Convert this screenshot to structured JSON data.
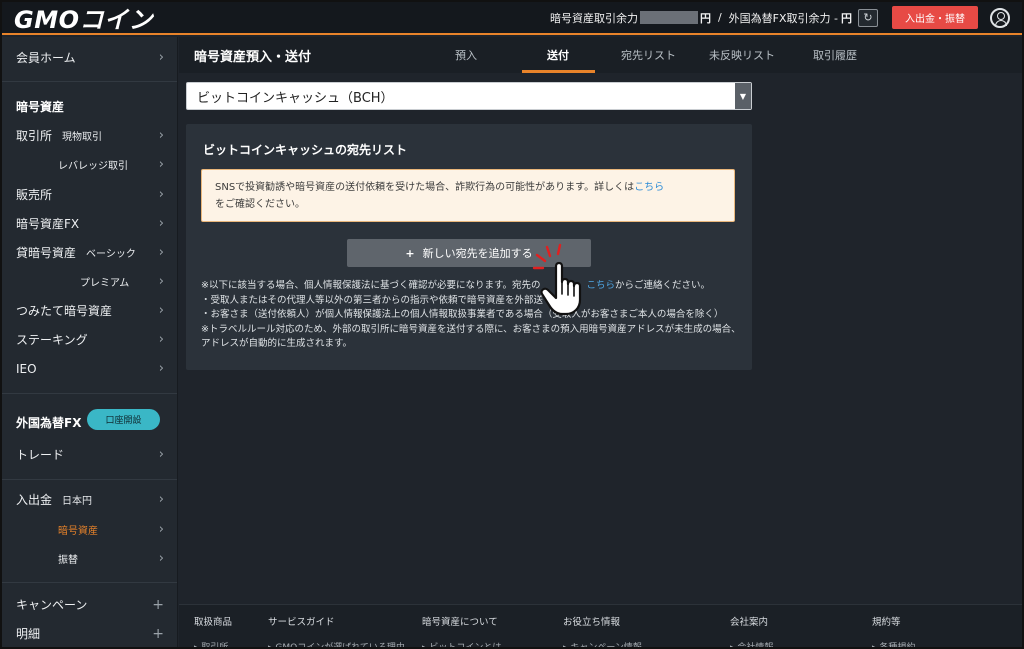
{
  "header": {
    "logo": "GMOコイン",
    "crypto_balance_label": "暗号資産取引余力",
    "crypto_balance_unit": "円",
    "separator": "/",
    "fx_balance_label": "外国為替FX取引余力 -",
    "fx_balance_unit": "円",
    "refresh_icon": "refresh-icon",
    "deposit_button": "入出金・振替"
  },
  "sidebar": {
    "member_home": "会員ホーム",
    "crypto_heading": "暗号資産",
    "exchange": "取引所",
    "exchange_spot": "現物取引",
    "exchange_leverage": "レバレッジ取引",
    "sales": "販売所",
    "crypto_fx": "暗号資産FX",
    "lending": "貸暗号資産",
    "lending_basic": "ベーシック",
    "lending_premium": "プレミアム",
    "tsumitate": "つみたて暗号資産",
    "staking": "ステーキング",
    "ieo": "IEO",
    "fx_heading": "外国為替FX",
    "fx_open_account": "口座開設",
    "trade": "トレード",
    "deposit": "入出金",
    "deposit_jpy": "日本円",
    "deposit_crypto": "暗号資産",
    "transfer": "振替",
    "campaign": "キャンペーン",
    "statement": "明細"
  },
  "main": {
    "page_title": "暗号資産預入・送付",
    "tabs": [
      {
        "label": "預入",
        "active": false
      },
      {
        "label": "送付",
        "active": true
      },
      {
        "label": "宛先リスト",
        "active": false
      },
      {
        "label": "未反映リスト",
        "active": false
      },
      {
        "label": "取引履歴",
        "active": false
      }
    ],
    "currency_select_value": "ビットコインキャッシュ（BCH）",
    "panel_title": "ビットコインキャッシュの宛先リスト",
    "warning_text": "SNSで投資勧誘や暗号資産の送付依頼を受けた場合、詐欺行為の可能性があります。詳しくは",
    "warning_link": "こちら",
    "warning_text_end": "をご確認ください。",
    "add_button": "新しい宛先を追加する",
    "notes": {
      "line1_start": "※以下に該当する場合、個人情報保護法に基づく確認が必要になります。宛先の",
      "line1_link": "こちら",
      "line1_end": "からご連絡ください。",
      "line2": "・受取人またはその代理人等以外の第三者からの指示や依頼で暗号資産を外部送",
      "line3": "・お客さま（送付依頼人）が個人情報保護法上の個人情報取扱事業者である場合（受取人がお客さまご本人の場合を除く）",
      "line4": "※トラベルルール対応のため、外部の取引所に暗号資産を送付する際に、お客さまの預入用暗号資産アドレスが未生成の場合、アドレスが自動的に生成されます。"
    }
  },
  "footer": {
    "columns": [
      {
        "heading": "取扱商品",
        "link": "▸ 取引所"
      },
      {
        "heading": "サービスガイド",
        "link": "▸ GMOコインが選ばれている理由"
      },
      {
        "heading": "暗号資産について",
        "link": "▸ ビットコインとは"
      },
      {
        "heading": "お役立ち情報",
        "link": "▸ キャンペーン情報"
      },
      {
        "heading": "会社案内",
        "link": "▸ 会社情報"
      },
      {
        "heading": "規約等",
        "link": "▸ 各種規約"
      }
    ]
  }
}
